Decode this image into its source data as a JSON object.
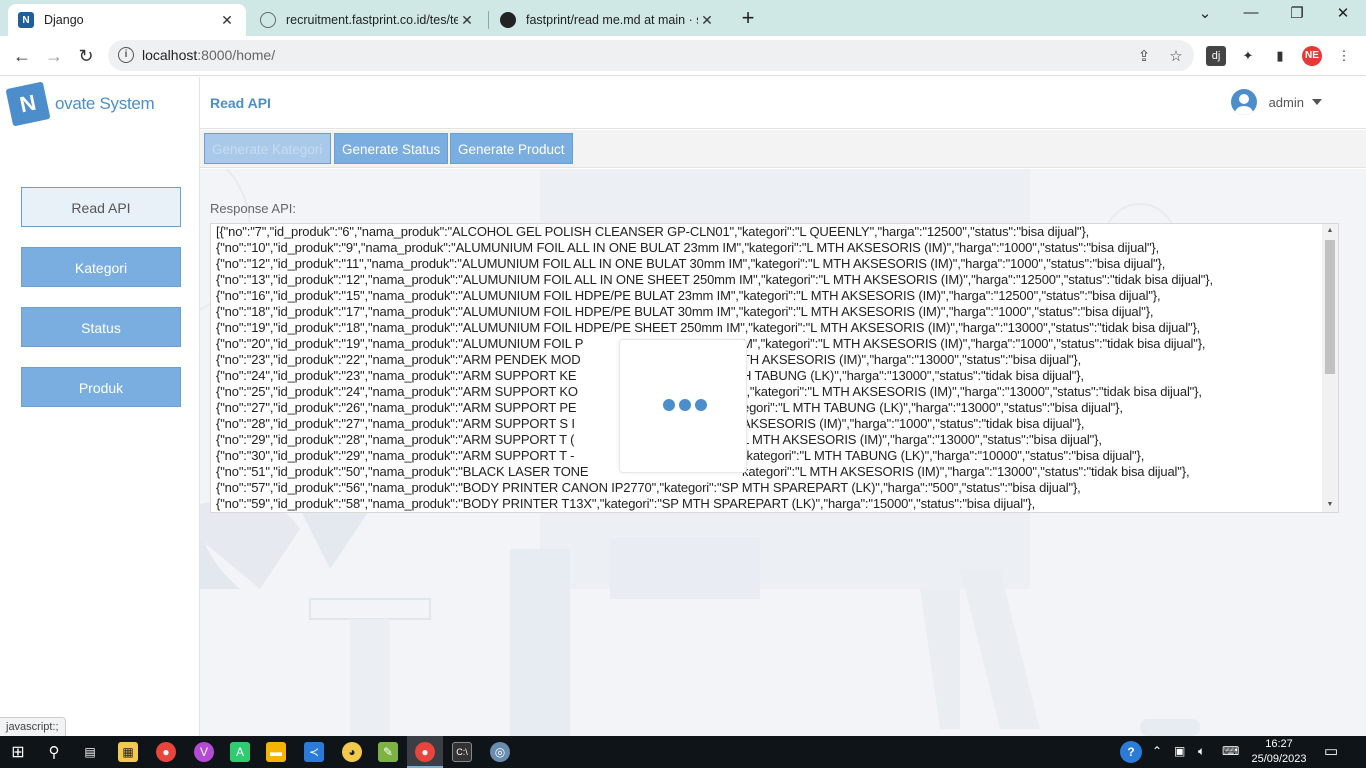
{
  "browser": {
    "tabs": [
      {
        "title": "Django",
        "active": true
      },
      {
        "title": "recruitment.fastprint.co.id/tes/te",
        "active": false
      },
      {
        "title": "fastprint/read me.md at main · sl",
        "active": false
      }
    ],
    "new_tab_label": "+",
    "url_host": "localhost",
    "url_rest": ":8000/home/",
    "status_text": "javascript:;"
  },
  "app": {
    "logo_letter": "N",
    "logo_text": "ovate System",
    "page_title": "Read API",
    "user_name": "admin",
    "sidebar": [
      {
        "label": "Read API",
        "active": true
      },
      {
        "label": "Kategori",
        "active": false
      },
      {
        "label": "Status",
        "active": false
      },
      {
        "label": "Produk",
        "active": false
      }
    ],
    "generate_buttons": [
      {
        "label": "Generate Kategori",
        "busy": true
      },
      {
        "label": "Generate Status",
        "busy": false
      },
      {
        "label": "Generate Product",
        "busy": false
      }
    ],
    "response_label": "Response API:",
    "response_lines": [
      "[{\"no\":\"7\",\"id_produk\":\"6\",\"nama_produk\":\"ALCOHOL GEL POLISH CLEANSER GP-CLN01\",\"kategori\":\"L QUEENLY\",\"harga\":\"12500\",\"status\":\"bisa dijual\"},",
      "{\"no\":\"10\",\"id_produk\":\"9\",\"nama_produk\":\"ALUMUNIUM FOIL ALL IN ONE BULAT 23mm IM\",\"kategori\":\"L MTH AKSESORIS (IM)\",\"harga\":\"1000\",\"status\":\"bisa dijual\"},",
      "{\"no\":\"12\",\"id_produk\":\"11\",\"nama_produk\":\"ALUMUNIUM FOIL ALL IN ONE BULAT 30mm IM\",\"kategori\":\"L MTH AKSESORIS (IM)\",\"harga\":\"1000\",\"status\":\"bisa dijual\"},",
      "{\"no\":\"13\",\"id_produk\":\"12\",\"nama_produk\":\"ALUMUNIUM FOIL ALL IN ONE SHEET 250mm IM\",\"kategori\":\"L MTH AKSESORIS (IM)\",\"harga\":\"12500\",\"status\":\"tidak bisa dijual\"},",
      "{\"no\":\"16\",\"id_produk\":\"15\",\"nama_produk\":\"ALUMUNIUM FOIL HDPE/PE BULAT 23mm IM\",\"kategori\":\"L MTH AKSESORIS (IM)\",\"harga\":\"12500\",\"status\":\"bisa dijual\"},",
      "{\"no\":\"18\",\"id_produk\":\"17\",\"nama_produk\":\"ALUMUNIUM FOIL HDPE/PE BULAT 30mm IM\",\"kategori\":\"L MTH AKSESORIS (IM)\",\"harga\":\"1000\",\"status\":\"bisa dijual\"},",
      "{\"no\":\"19\",\"id_produk\":\"18\",\"nama_produk\":\"ALUMUNIUM FOIL HDPE/PE SHEET 250mm IM\",\"kategori\":\"L MTH AKSESORIS (IM)\",\"harga\":\"13000\",\"status\":\"tidak bisa dijual\"},",
      "{\"no\":\"20\",\"id_produk\":\"19\",\"nama_produk\":\"ALUMUNIUM FOIL P",
      "{\"no\":\"23\",\"id_produk\":\"22\",\"nama_produk\":\"ARM PENDEK MOD",
      "{\"no\":\"24\",\"id_produk\":\"23\",\"nama_produk\":\"ARM SUPPORT KE",
      "{\"no\":\"25\",\"id_produk\":\"24\",\"nama_produk\":\"ARM SUPPORT KO",
      "{\"no\":\"27\",\"id_produk\":\"26\",\"nama_produk\":\"ARM SUPPORT PE",
      "{\"no\":\"28\",\"id_produk\":\"27\",\"nama_produk\":\"ARM SUPPORT S I",
      "{\"no\":\"29\",\"id_produk\":\"28\",\"nama_produk\":\"ARM SUPPORT T (",
      "{\"no\":\"30\",\"id_produk\":\"29\",\"nama_produk\":\"ARM SUPPORT T -",
      "{\"no\":\"51\",\"id_produk\":\"50\",\"nama_produk\":\"BLACK LASER TONE",
      "{\"no\":\"57\",\"id_produk\":\"56\",\"nama_produk\":\"BODY PRINTER CANON IP2770\",\"kategori\":\"SP MTH SPAREPART (LK)\",\"harga\":\"500\",\"status\":\"bisa dijual\"},",
      "{\"no\":\"59\",\"id_produk\":\"58\",\"nama_produk\":\"BODY PRINTER T13X\",\"kategori\":\"SP MTH SPAREPART (LK)\",\"harga\":\"15000\",\"status\":\"bisa dijual\"},"
    ],
    "response_tails": [
      "M\",\"kategori\":\"L MTH AKSESORIS (IM)\",\"harga\":\"1000\",\"status\":\"tidak bisa dijual\"},",
      "TH AKSESORIS (IM)\",\"harga\":\"13000\",\"status\":\"bisa dijual\"},",
      "H TABUNG (LK)\",\"harga\":\"13000\",\"status\":\"tidak bisa dijual\"},",
      "\",\"kategori\":\"L MTH AKSESORIS (IM)\",\"harga\":\"13000\",\"status\":\"tidak bisa dijual\"},",
      "egori\":\"L MTH TABUNG (LK)\",\"harga\":\"13000\",\"status\":\"bisa dijual\"},",
      "AKSESORIS (IM)\",\"harga\":\"1000\",\"status\":\"tidak bisa dijual\"},",
      "L MTH AKSESORIS (IM)\",\"harga\":\"13000\",\"status\":\"bisa dijual\"},",
      "\"kategori\":\"L MTH TABUNG (LK)\",\"harga\":\"10000\",\"status\":\"bisa dijual\"},",
      "kategori\":\"L MTH AKSESORIS (IM)\",\"harga\":\"13000\",\"status\":\"tidak bisa dijual\"},"
    ]
  },
  "taskbar": {
    "time": "16:27",
    "date": "25/09/2023"
  },
  "colors": {
    "accent": "#4b8ecb",
    "button": "#7aaee0",
    "tab_strip": "#cfe8e6"
  }
}
